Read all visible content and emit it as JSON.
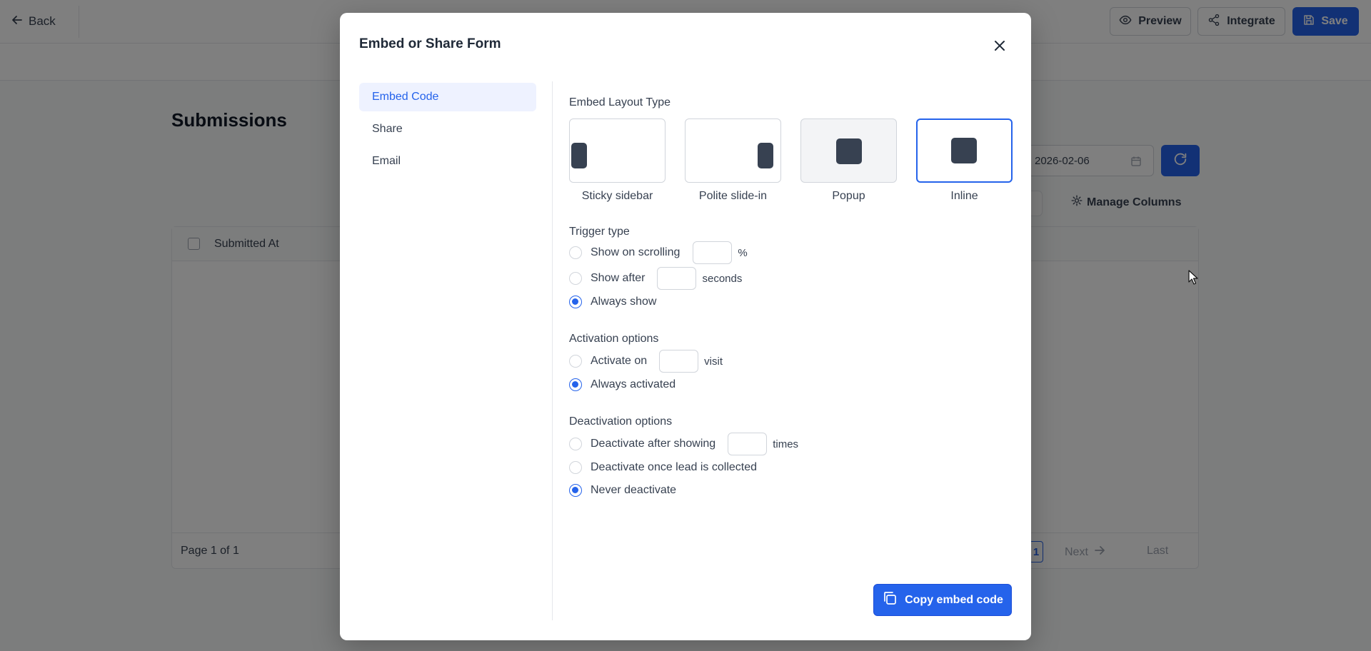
{
  "topbar": {
    "back_label": "Back",
    "preview_label": "Preview",
    "integrate_label": "Integrate",
    "save_label": "Save"
  },
  "page": {
    "title": "Submissions",
    "date_value": "2026-02-06",
    "manage_columns_label": "Manage Columns",
    "table": {
      "columns": [
        "Submitted At"
      ],
      "page_info": "Page 1 of 1",
      "current_page": "1",
      "next_label": "Next",
      "last_label": "Last"
    }
  },
  "modal": {
    "title": "Embed or Share Form",
    "nav": [
      {
        "label": "Embed Code",
        "active": true
      },
      {
        "label": "Share",
        "active": false
      },
      {
        "label": "Email",
        "active": false
      }
    ],
    "layout": {
      "title": "Embed Layout Type",
      "options": [
        {
          "label": "Sticky sidebar",
          "selected": false
        },
        {
          "label": "Polite slide-in",
          "selected": false
        },
        {
          "label": "Popup",
          "selected": false
        },
        {
          "label": "Inline",
          "selected": true
        }
      ]
    },
    "trigger": {
      "title": "Trigger type",
      "scrolling_label": "Show on scrolling",
      "scrolling_suffix": "%",
      "after_label": "Show after",
      "after_suffix": "seconds",
      "always_label": "Always show",
      "selected": "always"
    },
    "activation": {
      "title": "Activation options",
      "activate_on_label": "Activate on",
      "activate_on_suffix": "visit",
      "always_label": "Always activated",
      "selected": "always"
    },
    "deactivation": {
      "title": "Deactivation options",
      "after_label": "Deactivate after showing",
      "after_suffix": "times",
      "lead_label": "Deactivate once lead is collected",
      "never_label": "Never deactivate",
      "selected": "never"
    },
    "copy_button_label": "Copy embed code"
  },
  "colors": {
    "accent": "#2563eb",
    "overlay": "rgba(0,0,0,0.5)"
  }
}
